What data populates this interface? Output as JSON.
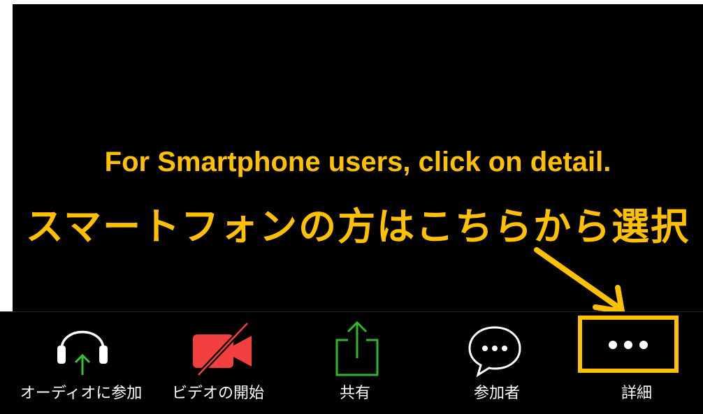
{
  "overlay": {
    "caption_en": "For Smartphone users, click on detail.",
    "caption_ja": "スマートフォンの方はこちらから選択",
    "accent_color": "#FFC000"
  },
  "toolbar": {
    "items": [
      {
        "label": "オーディオに参加",
        "icon": "headphones-join-audio-icon"
      },
      {
        "label": "ビデオの開始",
        "icon": "video-camera-off-icon"
      },
      {
        "label": "共有",
        "icon": "share-upload-icon"
      },
      {
        "label": "参加者",
        "icon": "chat-bubble-participants-icon"
      },
      {
        "label": "詳細",
        "icon": "more-dots-icon"
      }
    ]
  },
  "colors": {
    "background": "#000000",
    "icon_white": "#ffffff",
    "video_red": "#F2403E",
    "share_green": "#2EB82E",
    "audio_arrow_green": "#35C235"
  }
}
